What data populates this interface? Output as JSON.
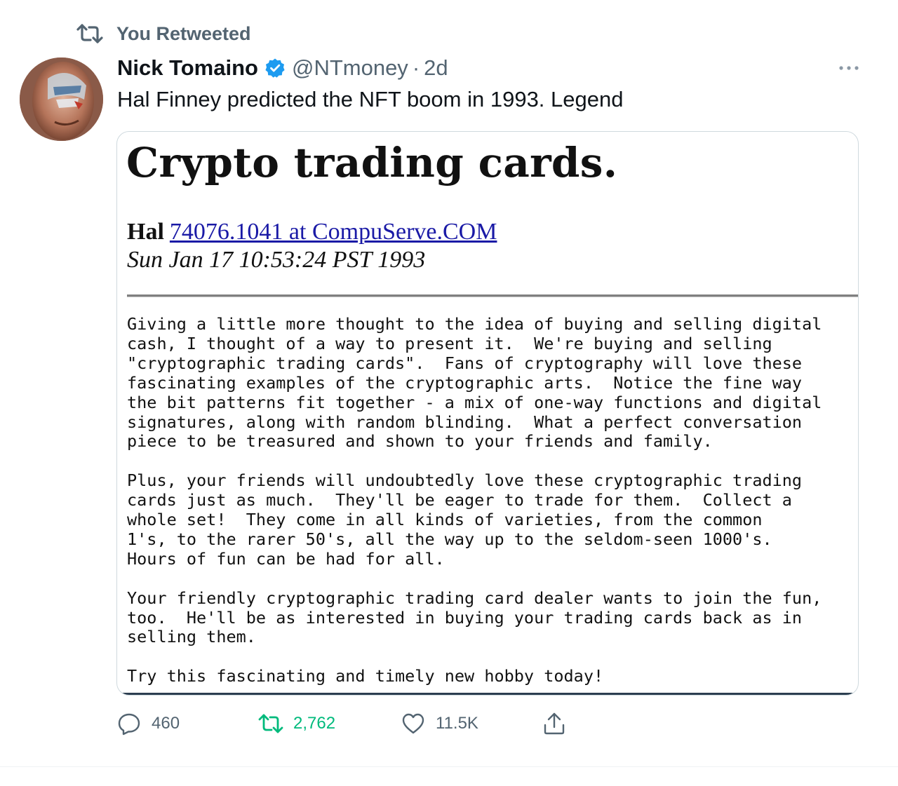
{
  "retweet_context": {
    "label": "You Retweeted"
  },
  "tweet": {
    "author": {
      "name": "Nick Tomaino",
      "handle": "@NTmoney",
      "verified": true,
      "time": "2d",
      "separator": "·"
    },
    "text": "Hal Finney predicted the NFT boom in 1993. Legend",
    "media": {
      "title": "Crypto trading cards.",
      "author_name": "Hal",
      "author_link": "74076.1041 at CompuServe.COM",
      "date": "Sun Jan 17 10:53:24 PST 1993",
      "paragraphs": [
        "Giving a little more thought to the idea of buying and selling digital\ncash, I thought of a way to present it.  We're buying and selling\n\"cryptographic trading cards\".  Fans of cryptography will love these\nfascinating examples of the cryptographic arts.  Notice the fine way\nthe bit patterns fit together - a mix of one-way functions and digital\nsignatures, along with random blinding.  What a perfect conversation\npiece to be treasured and shown to your friends and family.",
        "Plus, your friends will undoubtedly love these cryptographic trading\ncards just as much.  They'll be eager to trade for them.  Collect a\nwhole set!  They come in all kinds of varieties, from the common\n1's, to the rarer 50's, all the way up to the seldom-seen 1000's.\nHours of fun can be had for all.",
        "Your friendly cryptographic trading card dealer wants to join the fun,\ntoo.  He'll be as interested in buying your trading cards back as in\nselling them.",
        "Try this fascinating and timely new hobby today!"
      ]
    },
    "actions": {
      "replies": "460",
      "retweets": "2,762",
      "likes": "11.5K"
    }
  },
  "icons": {
    "retweet_context": "retweet-icon",
    "verified": "verified-badge-icon",
    "more": "more-options-icon",
    "reply": "reply-icon",
    "retweet": "retweet-icon",
    "like": "heart-icon",
    "share": "share-icon"
  },
  "colors": {
    "text_primary": "#0f1419",
    "text_secondary": "#536471",
    "verified_blue": "#1d9bf0",
    "retweet_green": "#00ba7c",
    "link_blue": "#1a1aa6",
    "card_border": "#cfd9de"
  }
}
